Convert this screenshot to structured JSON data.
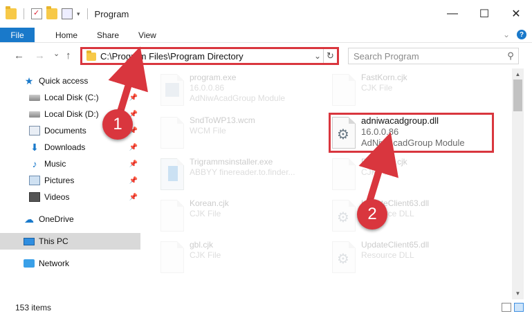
{
  "window": {
    "title": "Program",
    "minimize": "—",
    "maximize": "☐",
    "close": "✕"
  },
  "ribbon": {
    "tabs": [
      "File",
      "Home",
      "Share",
      "View"
    ],
    "expand_icon": "chevron-down-icon",
    "help_label": "?"
  },
  "nav": {
    "back": "←",
    "forward": "→",
    "recent": "⌄",
    "up": "↑"
  },
  "address": {
    "path": "C:\\Program Files\\Program Directory",
    "dropdown": "⌄",
    "refresh": "↻"
  },
  "search": {
    "placeholder": "Search Program",
    "icon": "⚲"
  },
  "sidebar": {
    "items": [
      {
        "label": "Quick access",
        "icon": "star-icon",
        "pinned": false
      },
      {
        "label": "Local Disk (C:)",
        "icon": "disk-icon",
        "pinned": true
      },
      {
        "label": "Local Disk (D:)",
        "icon": "disk-icon",
        "pinned": true
      },
      {
        "label": "Documents",
        "icon": "documents-icon",
        "pinned": true
      },
      {
        "label": "Downloads",
        "icon": "download-icon",
        "pinned": true
      },
      {
        "label": "Music",
        "icon": "music-icon",
        "pinned": true
      },
      {
        "label": "Pictures",
        "icon": "pictures-icon",
        "pinned": true
      },
      {
        "label": "Videos",
        "icon": "videos-icon",
        "pinned": true
      },
      {
        "label": "OneDrive",
        "icon": "cloud-icon",
        "pinned": false
      },
      {
        "label": "This PC",
        "icon": "computer-icon",
        "pinned": false,
        "selected": true
      },
      {
        "label": "Network",
        "icon": "network-icon",
        "pinned": false
      }
    ]
  },
  "files": [
    {
      "name": "program.exe",
      "line2": "16.0.0.86",
      "line3": "AdNiwAcadGroup Module",
      "icon": "exe-icon"
    },
    {
      "name": "FastKorn.cjk",
      "line2": "CJK File",
      "line3": "",
      "icon": "file-icon"
    },
    {
      "name": "SndToWP13.wcm",
      "line2": "WCM File",
      "line3": "",
      "icon": "file-icon"
    },
    {
      "name": "adniwacadgroup.dll",
      "line2": "16.0.0.86",
      "line3": "AdNiwAcadGroup Module",
      "icon": "gear-icon",
      "highlighted": true
    },
    {
      "name": "Trigrammsinstaller.exe",
      "line2": "ABBYY finereader.to.finder...",
      "line3": "",
      "icon": "installer-icon"
    },
    {
      "name": "FastKorn.cjk",
      "line2": "CJK File",
      "line3": "",
      "icon": "file-icon"
    },
    {
      "name": "Korean.cjk",
      "line2": "CJK File",
      "line3": "",
      "icon": "file-icon"
    },
    {
      "name": "UpdateClient63.dll",
      "line2": "Resource DLL",
      "line3": "",
      "icon": "gear-icon"
    },
    {
      "name": "gbl.cjk",
      "line2": "CJK File",
      "line3": "",
      "icon": "file-icon"
    },
    {
      "name": "UpdateClient65.dll",
      "line2": "Resource DLL",
      "line3": "",
      "icon": "gear-icon"
    }
  ],
  "status": {
    "item_count": "153 items"
  },
  "annotations": {
    "step1": "1",
    "step2": "2",
    "color": "#d9363e"
  },
  "colors": {
    "accent": "#1979ca",
    "highlight": "#d9363e",
    "selected_bg": "#d9d9d9"
  }
}
